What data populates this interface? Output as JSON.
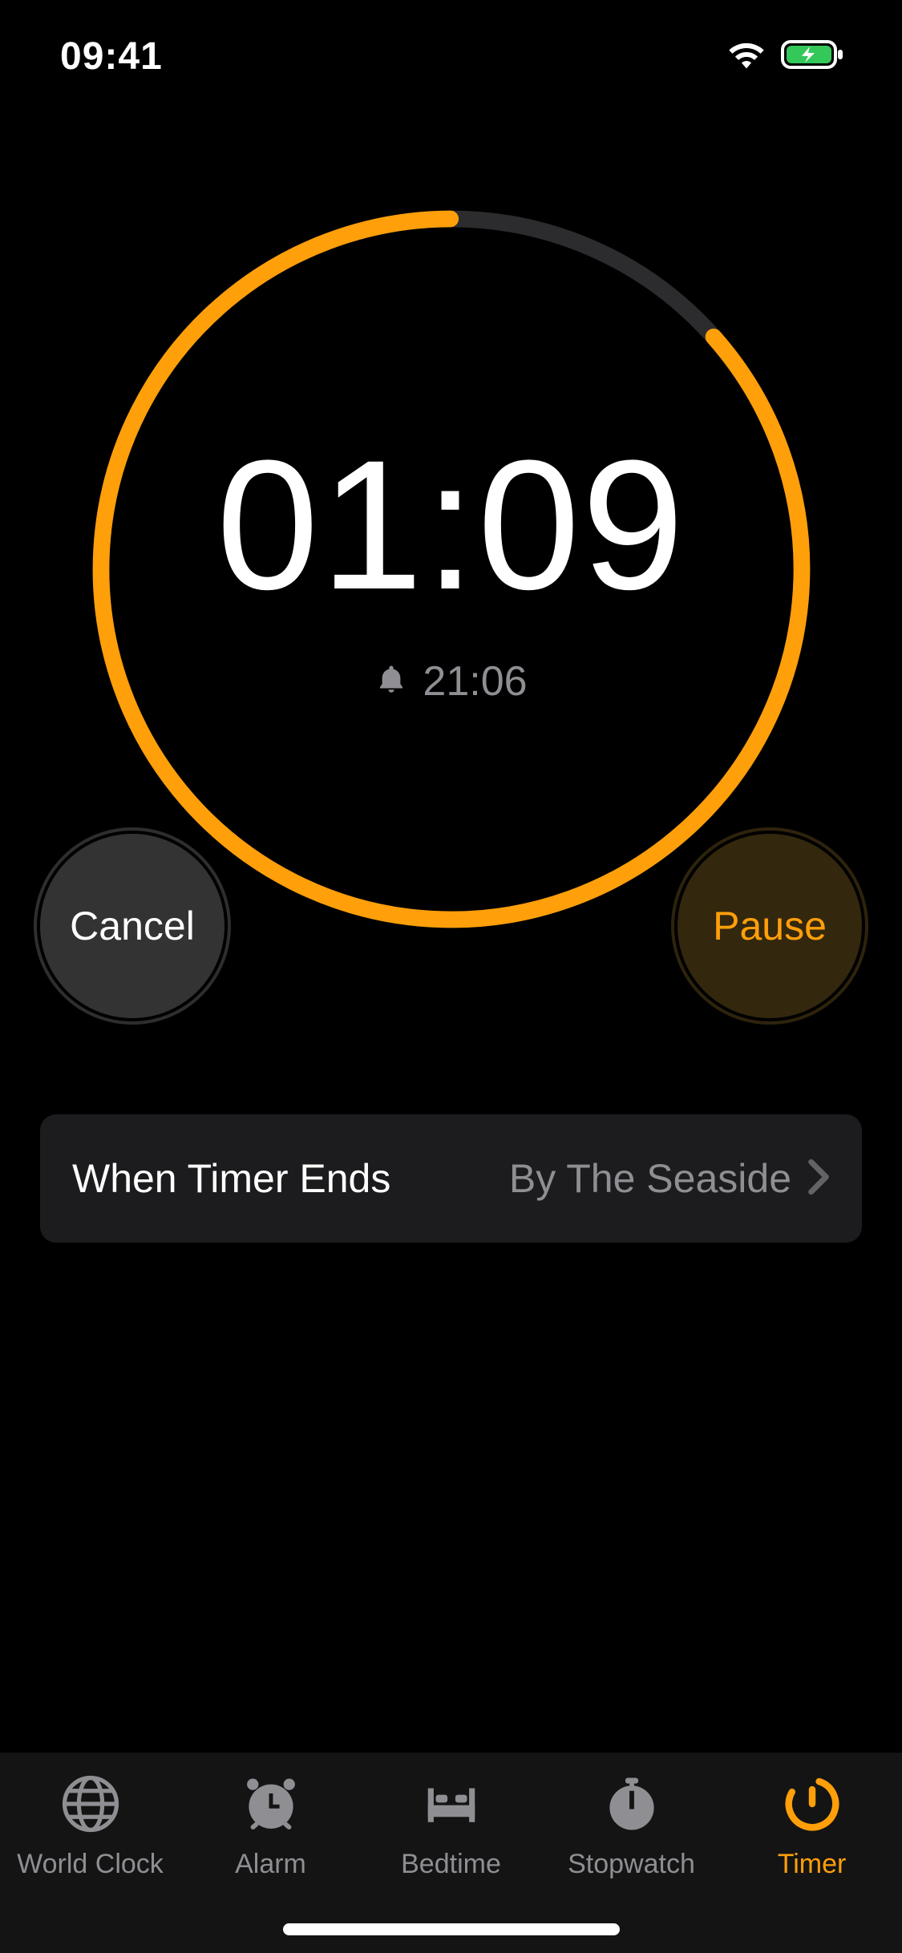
{
  "status": {
    "time": "09:41"
  },
  "timer": {
    "remaining": "01:09",
    "end_time": "21:06",
    "progress_fraction_elapsed": 0.135,
    "accent_color": "#ff9f0a"
  },
  "buttons": {
    "cancel_label": "Cancel",
    "pause_label": "Pause"
  },
  "ends_row": {
    "label": "When Timer Ends",
    "value": "By The Seaside"
  },
  "tabs": {
    "world_clock": "World Clock",
    "alarm": "Alarm",
    "bedtime": "Bedtime",
    "stopwatch": "Stopwatch",
    "timer": "Timer",
    "active": "timer"
  }
}
